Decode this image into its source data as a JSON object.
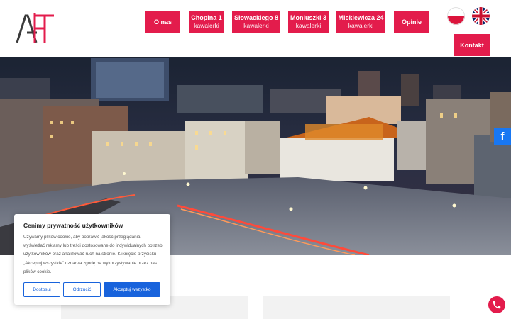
{
  "nav": {
    "items": [
      {
        "line1": "O nas",
        "line2": ""
      },
      {
        "line1": "Chopina 1",
        "line2": "kawalerki"
      },
      {
        "line1": "Słowackiego 8",
        "line2": "kawalerki"
      },
      {
        "line1": "Moniuszki 3",
        "line2": "kawalerki"
      },
      {
        "line1": "Mickiewicza 24",
        "line2": "kawalerki"
      },
      {
        "line1": "Opinie",
        "line2": ""
      }
    ],
    "kontakt": "Kontakt"
  },
  "colors": {
    "brand": "#e31c4c",
    "cookie_accent": "#1863dc",
    "facebook": "#1877f2"
  },
  "icons": {
    "logo": "aht-logo",
    "lang_pl": "poland-flag-icon",
    "lang_en": "uk-flag-icon",
    "social": "facebook-icon",
    "call": "phone-icon"
  },
  "cookie": {
    "title": "Cenimy prywatność użytkowników",
    "text": "Używamy plików cookie, aby poprawić jakość przeglądania, wyświetlać reklamy lub treści dostosowane do indywidualnych potrzeb użytkowników oraz analizować ruch na stronie. Kliknięcie przycisku „Akceptuj wszystkie\" oznacza zgodę na wykorzystywanie przez nas plików cookie.",
    "btn_customize": "Dostosuj",
    "btn_reject": "Odrzucić",
    "btn_accept": "Akceptuj wszystko"
  },
  "social": {
    "facebook_glyph": "f"
  }
}
